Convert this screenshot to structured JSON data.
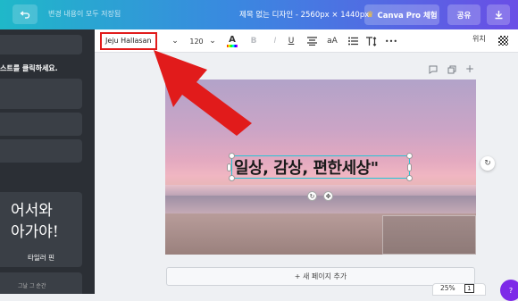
{
  "topbar": {
    "save_status": "변경 내용이 모두 저장됨",
    "doc_title": "제목 없는 디자인 - 2560px × 1440px",
    "pro_label": "Canva Pro 체험",
    "share_label": "공유"
  },
  "sidebar": {
    "hint": "스트를 클릭하세요.",
    "font_preview_line1": "어서와",
    "font_preview_line2": "아가야!",
    "font_preview_caption": "타일러 핀",
    "bottom_hint": "그날 그 순간"
  },
  "toolbar": {
    "font_name": "Jeju Hallasan",
    "font_size": "120",
    "bold": "B",
    "italic": "I",
    "underline": "U",
    "case": "aA",
    "more": "•••",
    "position": "위치"
  },
  "canvas": {
    "text": "일상, 감상, 편한세상\"",
    "add_page": "+ 새 페이지 추가",
    "zoom": "25%",
    "page_count": "1"
  },
  "colors": {
    "annotation": "#e11b1b",
    "selection": "#27c5d6",
    "brand_purple": "#7d2ae8"
  },
  "icons": [
    "undo-icon",
    "crown-icon",
    "download-icon",
    "chevron-down-icon",
    "text-color-icon",
    "align-icon",
    "list-icon",
    "line-spacing-icon",
    "transparency-icon",
    "comment-icon",
    "duplicate-icon",
    "add-icon",
    "rotate-icon",
    "move-icon",
    "refresh-icon",
    "collapse-icon"
  ]
}
